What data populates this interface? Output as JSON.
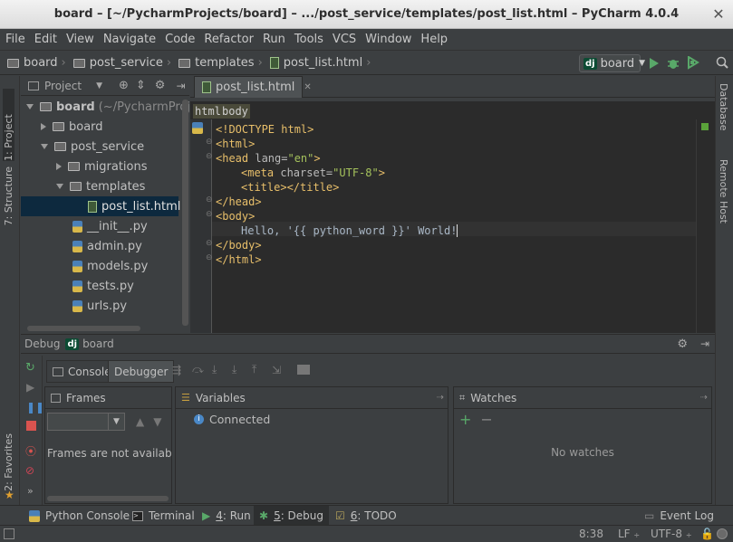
{
  "window": {
    "title": "board – [~/PycharmProjects/board] – .../post_service/templates/post_list.html – PyCharm 4.0.4"
  },
  "menu": [
    "File",
    "Edit",
    "View",
    "Navigate",
    "Code",
    "Refactor",
    "Run",
    "Tools",
    "VCS",
    "Window",
    "Help"
  ],
  "navbar": {
    "crumbs": [
      "board",
      "post_service",
      "templates",
      "post_list.html"
    ],
    "run_config": "board"
  },
  "left_stripe": {
    "project": "1: Project",
    "structure": "7: Structure",
    "favorites": "2: Favorites"
  },
  "right_stripe": {
    "database": "Database",
    "remote_host": "Remote Host"
  },
  "project_panel": {
    "title": "Project",
    "root_label": "board",
    "root_path": "(~/PycharmProj",
    "items": [
      "board",
      "post_service",
      "migrations",
      "templates",
      "post_list.html",
      "__init__.py",
      "admin.py",
      "models.py",
      "tests.py",
      "urls.py"
    ]
  },
  "editor": {
    "tab": "post_list.html",
    "tag_crumbs": [
      "html",
      "body"
    ],
    "lines": {
      "l1": "<!DOCTYPE html>",
      "l2": "<html>",
      "l3a": "<head ",
      "l3b": "lang=",
      "l3c": "\"en\"",
      "l3d": ">",
      "l4a": "<meta ",
      "l4b": "charset=",
      "l4c": "\"UTF-8\"",
      "l4d": ">",
      "l5a": "<title>",
      "l5b": "</title>",
      "l6": "</head>",
      "l7": "<body>",
      "l8": "Hello, '{{ python_word }}' World!",
      "l9": "</body>",
      "l10": "</html>"
    }
  },
  "debug": {
    "title": "Debug",
    "config": "board",
    "tabs": {
      "console": "Console",
      "debugger": "Debugger"
    },
    "frames": {
      "title": "Frames",
      "empty": "Frames are not availab"
    },
    "variables": {
      "title": "Variables",
      "status": "Connected"
    },
    "watches": {
      "title": "Watches",
      "empty": "No watches"
    }
  },
  "bottom_tools": {
    "python_console": "Python Console",
    "terminal": "Terminal",
    "run_num": "4",
    "run_label": ": Run",
    "debug_num": "5",
    "debug_label": ": Debug",
    "todo_num": "6",
    "todo_label": ": TODO",
    "event_log": "Event Log"
  },
  "status": {
    "position": "8:38",
    "line_sep": "LF",
    "encoding": "UTF-8"
  },
  "colors": {
    "bg": "#3c3f41",
    "editor_bg": "#2b2b2b",
    "tag": "#e8bf6a",
    "string": "#a5c25c",
    "selection": "#0d293e"
  }
}
